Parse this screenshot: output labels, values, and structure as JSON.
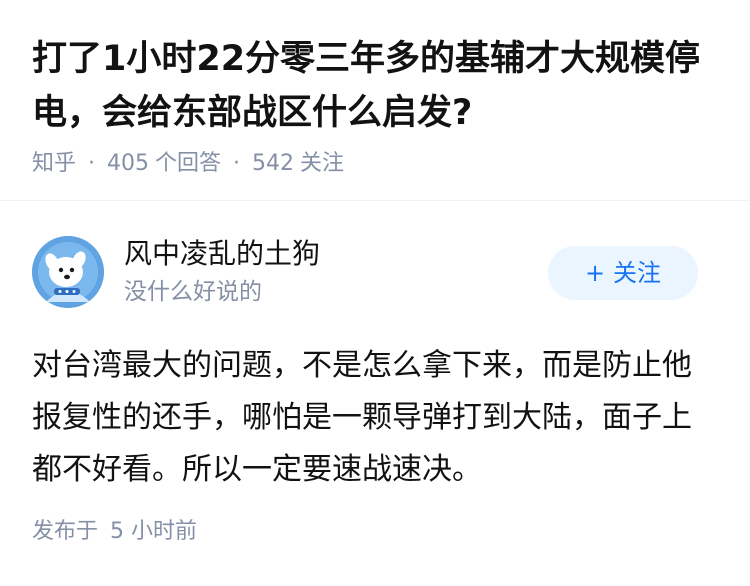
{
  "question": {
    "title": "打了1小时22分零三年多的基辅才大规模停电，会给东部战区什么启发?",
    "source": "知乎",
    "separator": "·",
    "answers_count": "405",
    "answers_label": "个回答",
    "followers_count": "542",
    "followers_label": "关注"
  },
  "author": {
    "name": "风中凌乱的土狗",
    "headline": "没什么好说的",
    "avatar_icon": "cartoon-dog-avatar-icon"
  },
  "follow_button": {
    "plus": "+",
    "label": "关注"
  },
  "answer": {
    "content": "对台湾最大的问题，不是怎么拿下来，而是防止他报复性的还手，哪怕是一颗导弹打到大陆，面子上都不好看。所以一定要速战速决。",
    "published_label": "发布于",
    "published_time": "5 小时前"
  },
  "colors": {
    "accent": "#1772f6",
    "accent_bg": "#ebf5ff",
    "meta_gray": "#8590a6",
    "text": "#121212"
  }
}
